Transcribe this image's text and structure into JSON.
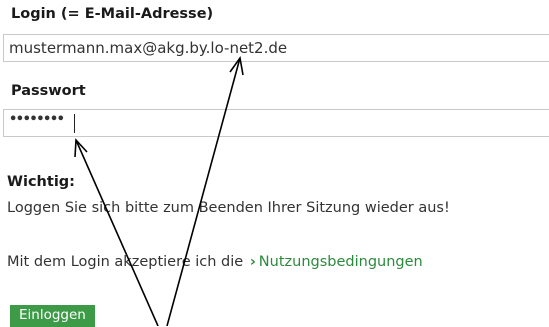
{
  "form": {
    "login_label": "Login (= E-Mail-Adresse)",
    "login_value": "mustermann.max@akg.by.lo-net2.de",
    "password_label": "Passwort",
    "password_masked": "••••••••",
    "important_label": "Wichtig:",
    "notice_text": "Loggen Sie sich bitte zum Beenden Ihrer Sitzung wieder aus!",
    "terms_prefix": "Mit dem Login akzeptiere ich die",
    "terms_chevron": "›",
    "terms_link": "Nutzungsbedingungen",
    "submit_label": "Einloggen"
  },
  "colors": {
    "accent": "#3d9a47",
    "link": "#2c8a3c"
  }
}
